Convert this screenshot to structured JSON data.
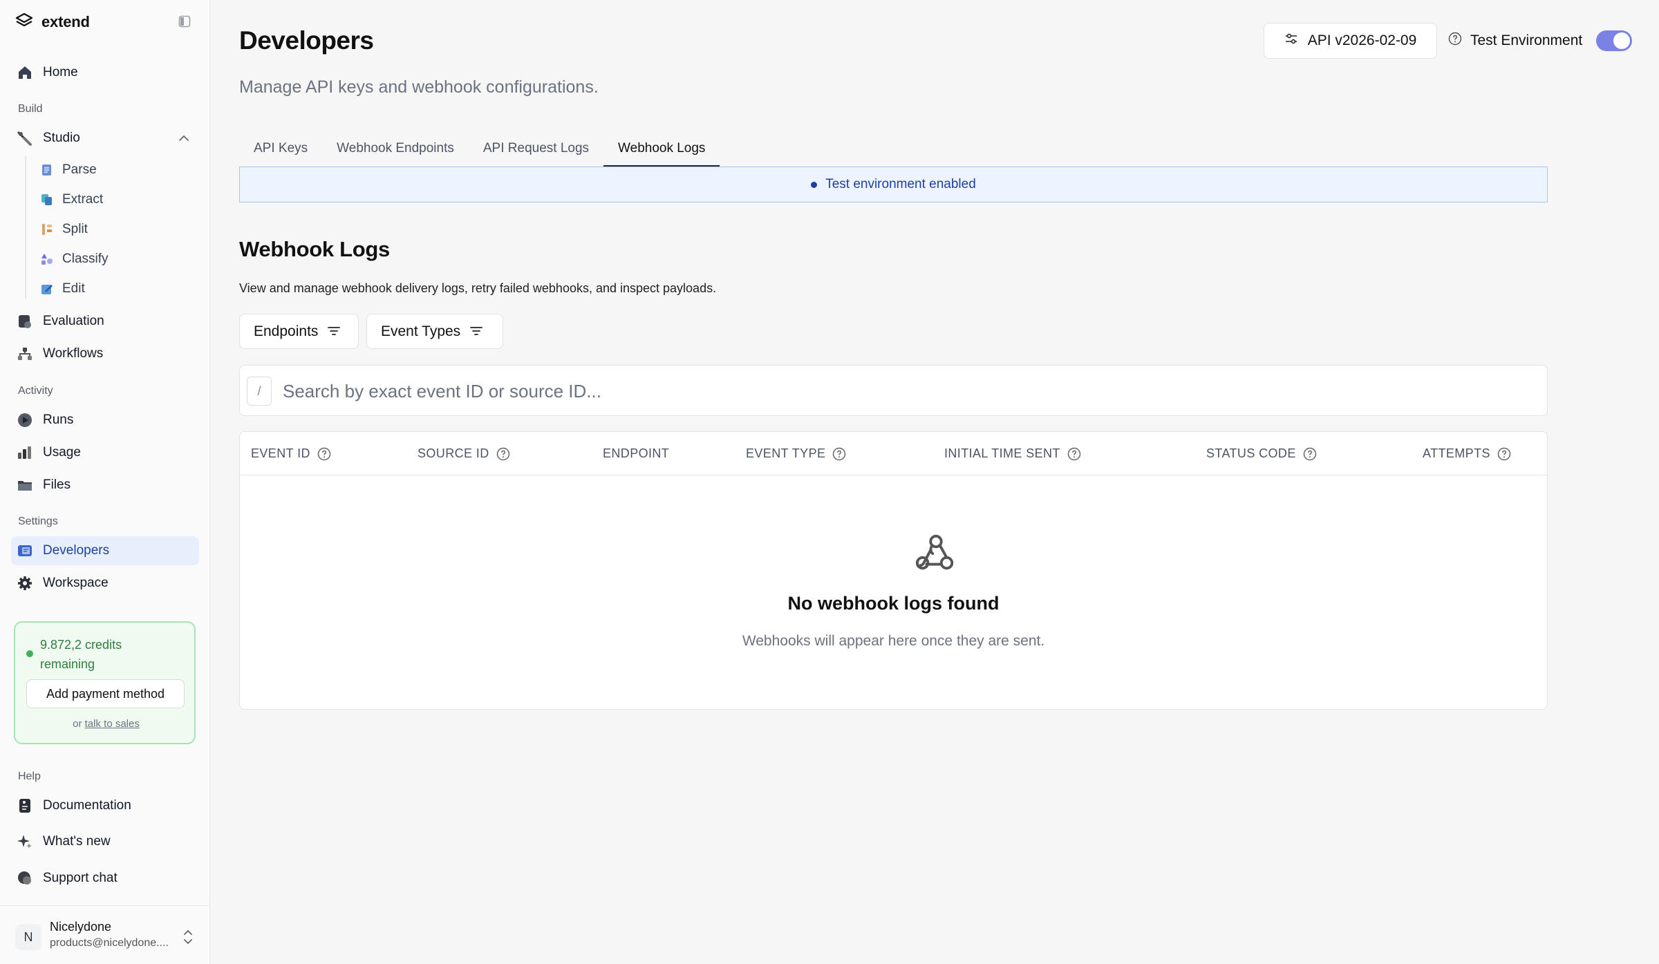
{
  "sidebar": {
    "brand": "extend",
    "home": "Home",
    "build_label": "Build",
    "studio": "Studio",
    "studio_items": [
      "Parse",
      "Extract",
      "Split",
      "Classify",
      "Edit"
    ],
    "evaluation": "Evaluation",
    "workflows": "Workflows",
    "activity_label": "Activity",
    "runs": "Runs",
    "usage": "Usage",
    "files": "Files",
    "settings_label": "Settings",
    "developers": "Developers",
    "workspace": "Workspace",
    "credits": {
      "text": "9.872,2 credits remaining",
      "button": "Add payment method",
      "or": "or",
      "sales_link": "talk to sales"
    },
    "help_label": "Help",
    "documentation": "Documentation",
    "whats_new": "What's new",
    "support_chat": "Support chat",
    "user": {
      "initial": "N",
      "name": "Nicelydone",
      "email": "products@nicelydone...."
    }
  },
  "header": {
    "title": "Developers",
    "subtitle": "Manage API keys and webhook configurations.",
    "api_version": "API v2026-02-09",
    "test_env_label": "Test Environment",
    "test_env_on": true
  },
  "tabs": [
    {
      "label": "API Keys",
      "active": false
    },
    {
      "label": "Webhook Endpoints",
      "active": false
    },
    {
      "label": "API Request Logs",
      "active": false
    },
    {
      "label": "Webhook Logs",
      "active": true
    }
  ],
  "banner": "Test environment enabled",
  "webhook_logs": {
    "title": "Webhook Logs",
    "description": "View and manage webhook delivery logs, retry failed webhooks, and inspect payloads.",
    "filters": [
      "Endpoints",
      "Event Types"
    ],
    "search": {
      "shortcut": "/",
      "placeholder": "Search by exact event ID or source ID..."
    },
    "columns": [
      "EVENT ID",
      "SOURCE ID",
      "ENDPOINT",
      "EVENT TYPE",
      "INITIAL TIME SENT",
      "STATUS CODE",
      "ATTEMPTS"
    ],
    "empty_title": "No webhook logs found",
    "empty_desc": "Webhooks will appear here once they are sent."
  },
  "colors": {
    "accent": "#1f3ea3",
    "toggle": "#7a82e6",
    "credits_green": "#3fb15a"
  }
}
